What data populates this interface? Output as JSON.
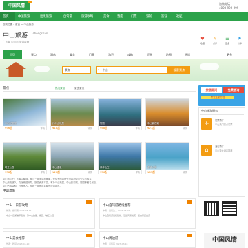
{
  "header": {
    "logo_text": "中国风情",
    "phone_label": "咨询电话",
    "phone_number": "4000-999-999"
  },
  "nav": {
    "items": [
      "首页",
      "中国旅游",
      "出境旅游",
      "自驾游",
      "旅游攻略",
      "美食",
      "酒店",
      "门票",
      "游轮",
      "签证",
      "社区"
    ]
  },
  "breadcrumb": "您的位置：首页 > 中山旅游",
  "city": {
    "name": "中山旅游",
    "pinyin": "Zhongshan",
    "subtitle": "广东省 中山市 旅游攻略"
  },
  "header_icons": [
    {
      "glyph": "♥",
      "label": "收藏"
    },
    {
      "glyph": "✎",
      "label": "点评"
    },
    {
      "glyph": "☰",
      "label": "更多"
    },
    {
      "glyph": "⚑",
      "label": "分享"
    }
  ],
  "tabs": [
    "首页",
    "景点",
    "酒店",
    "美食",
    "门票",
    "游记",
    "攻略",
    "问答",
    "地图",
    "图片",
    "更多"
  ],
  "search": {
    "select_value": "景点",
    "input_value": "中山",
    "button_label": "搜索景点"
  },
  "section_spots": {
    "title": "景点",
    "link_hot": "热门景点",
    "link_more": "更多景点",
    "cards": [
      {
        "caption": "中山纪念堂",
        "price": "¥96起",
        "link": "详情"
      },
      {
        "caption": "孙中山故居",
        "price": "¥15起",
        "link": "详情"
      },
      {
        "caption": "詹园",
        "price": "¥68起",
        "link": "详情"
      },
      {
        "caption": "中山影视城",
        "price": "¥21起",
        "link": "详情"
      },
      {
        "caption": "岐江公园",
        "price": "¥38起",
        "link": "详情"
      },
      {
        "caption": "中山温泉",
        "price": "¥20起",
        "link": "详情"
      },
      {
        "caption": "泉林山庄",
        "price": "¥56起",
        "link": "详情"
      },
      {
        "caption": "金钟水库",
        "price": "¥65起",
        "link": "详情"
      }
    ]
  },
  "section_intro": {
    "text_1": "中山市位于广东省中南部，珠江三角洲中部偏南，是伟大的革命先行者孙中山先生的故乡。",
    "text_2": "中山历史悠久，文化底蕴深厚，旅游资源丰富，有孙中山故居、中山影视城、詹园等著名景点。",
    "text_3": "中山气候温和，四季宜人，是珠三角地区重要的旅游城市。"
  },
  "section_guides": {
    "title": "中山攻略",
    "more": "更多",
    "articles": [
      {
        "title": "中山一日游攻略",
        "meta": "作者：旅行者  2023-05-12",
        "excerpt": "中山一日游推荐路线，孙中山故居、詹园、岐江公园"
      },
      {
        "title": "中山自驾游路线推荐",
        "meta": "作者：自驾达人  2023-06-02",
        "excerpt": "中山自驾游最佳路线，沿途风景优美，适合家庭出游"
      },
      {
        "title": "中山美食推荐",
        "meta": "作者：吃货  2023-04-20",
        "excerpt": "中山特色美食：石岐乳鸽、杏仁饼、脆肉鲩"
      },
      {
        "title": "中山周边游",
        "meta": "作者：背包客  2023-03-18",
        "excerpt": "中山周边值得一去的景点推荐"
      }
    ]
  },
  "sidebar": {
    "ad_line1": "旅游顾问",
    "ad_line2": "免费咨询",
    "ad_line3": "专业定制行程",
    "box_title": "中山旅游服务",
    "items": [
      {
        "title": "门票预订",
        "desc": "中山热门景点门票"
      },
      {
        "title": "酒店预订",
        "desc": "中山特价酒店推荐"
      }
    ],
    "bottom_banner": "中国风情"
  },
  "colors": {
    "brand_green": "#2ca24a",
    "accent_orange": "#f39c12",
    "price_orange": "#f08300"
  }
}
